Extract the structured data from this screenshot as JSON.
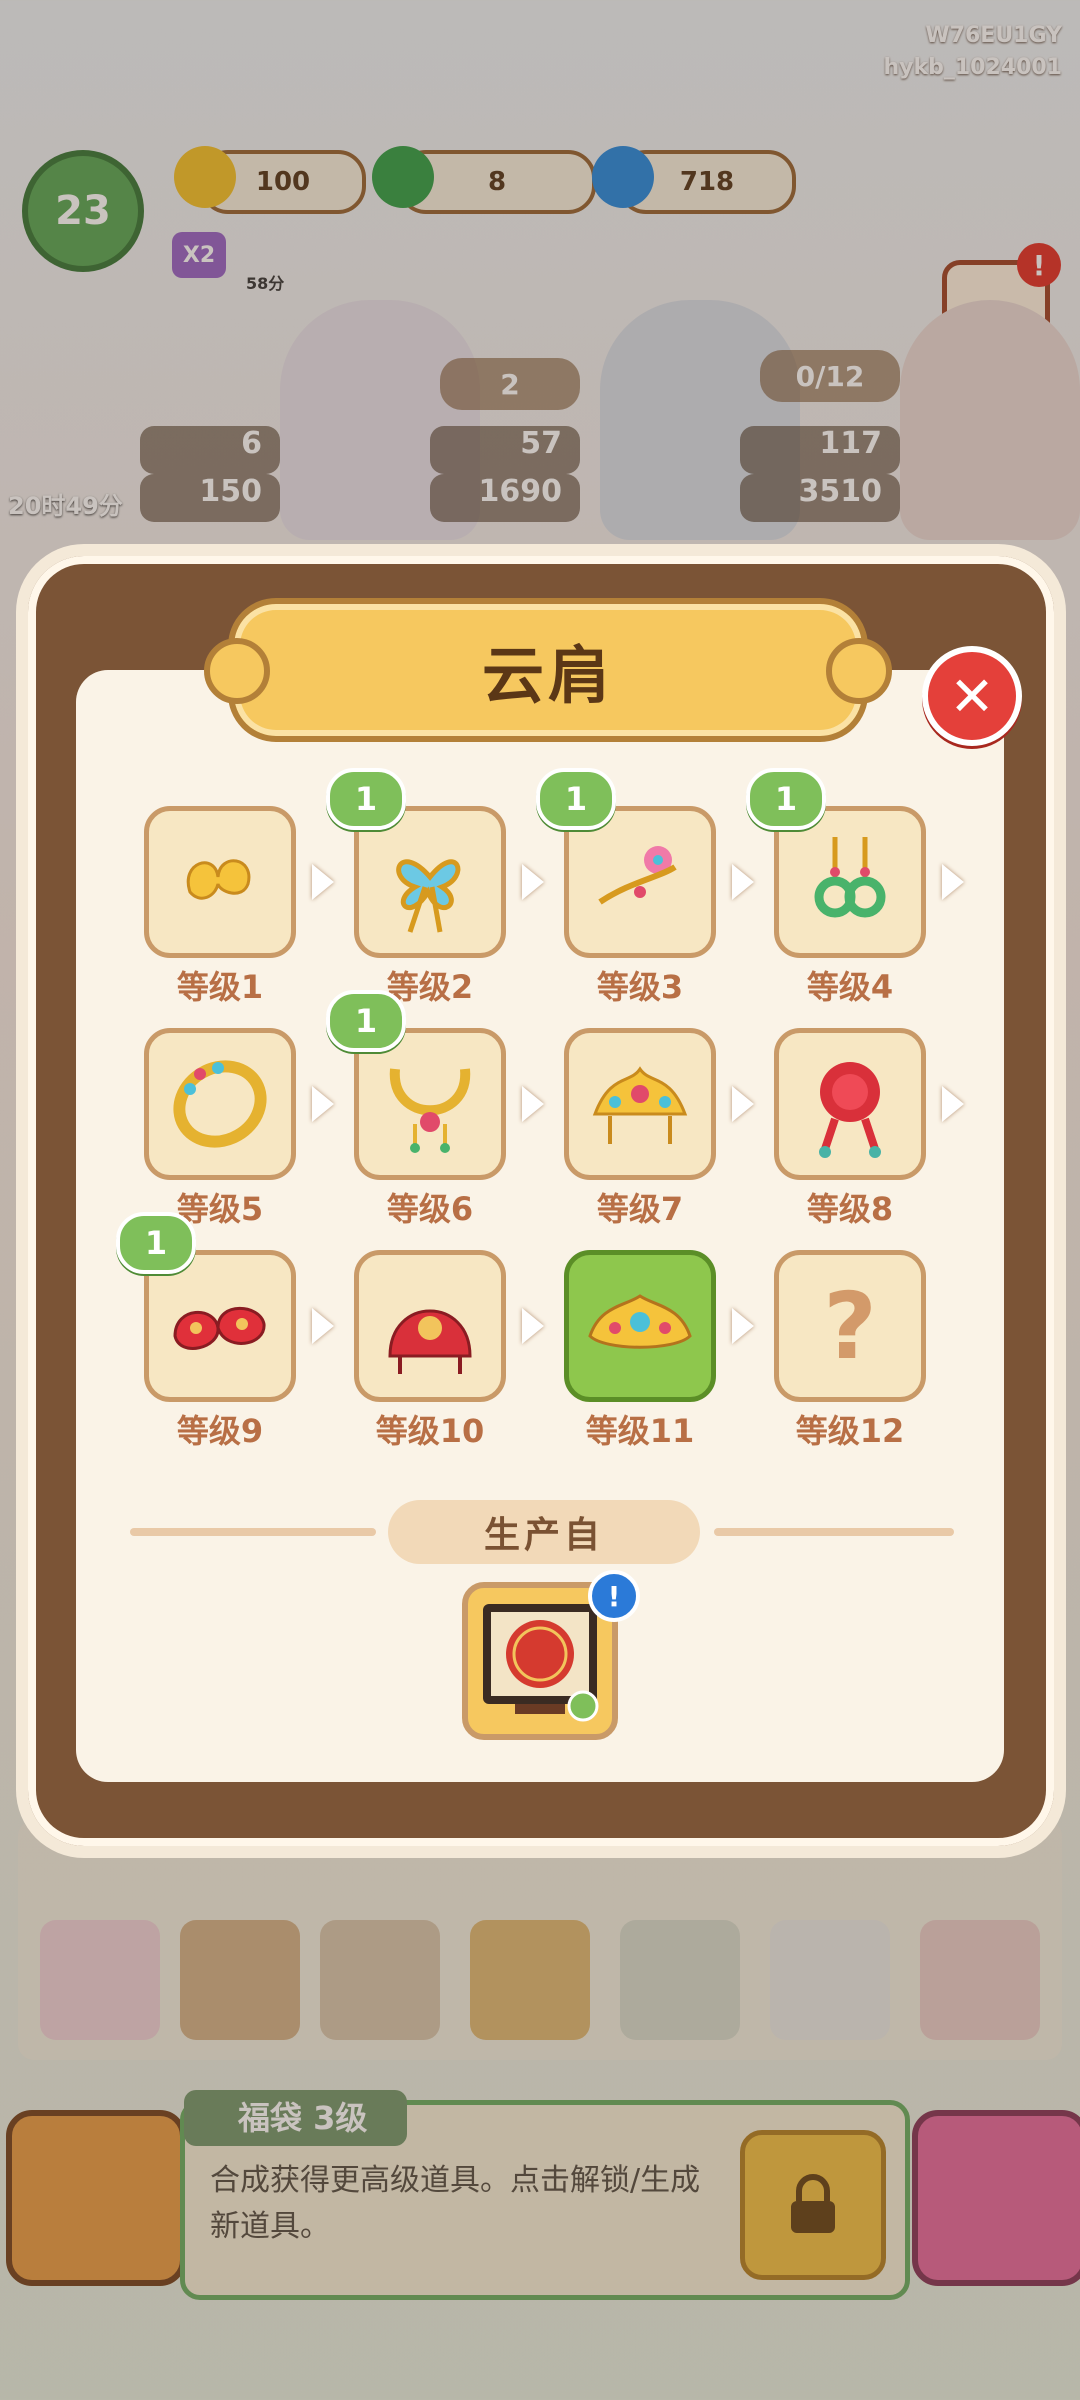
{
  "device_ids": {
    "line1": "W76EU1GY",
    "line2": "hykb_1024001"
  },
  "hud": {
    "player_level": "23",
    "energy": "100",
    "coins": "8",
    "gems": "718",
    "multiplier": "X2",
    "energy_timer": "58分",
    "orders": [
      {
        "top": "2",
        "coins": "57",
        "gems": "1690"
      },
      {
        "top": "0/12",
        "coins": "117",
        "gems": "3510"
      }
    ],
    "left_order": {
      "coins": "6",
      "gems": "150"
    },
    "event_timer": "20时49分",
    "shop_alert": "!"
  },
  "modal": {
    "title": "云肩",
    "close_icon": "close-icon",
    "levels": [
      {
        "label": "等级1",
        "icon": "ginkgo-hairpin-icon",
        "badge": ""
      },
      {
        "label": "等级2",
        "icon": "butterfly-hairpin-icon",
        "badge": "1"
      },
      {
        "label": "等级3",
        "icon": "flower-hairpin-icon",
        "badge": "1"
      },
      {
        "label": "等级4",
        "icon": "jade-earrings-icon",
        "badge": "1"
      },
      {
        "label": "等级5",
        "icon": "jeweled-bracelet-icon",
        "badge": ""
      },
      {
        "label": "等级6",
        "icon": "gold-necklace-icon",
        "badge": "1"
      },
      {
        "label": "等级7",
        "icon": "phoenix-crown-icon",
        "badge": ""
      },
      {
        "label": "等级8",
        "icon": "red-knot-icon",
        "badge": ""
      },
      {
        "label": "等级9",
        "icon": "embroidered-shoes-icon",
        "badge": "1"
      },
      {
        "label": "等级10",
        "icon": "red-veil-icon",
        "badge": ""
      },
      {
        "label": "等级11",
        "icon": "cloud-collar-icon",
        "badge": ""
      },
      {
        "label": "等级12",
        "icon": "unknown-item-icon",
        "badge": "",
        "unknown_mark": "?"
      }
    ],
    "produced_from_label": "生产自",
    "source_icon": "embroidery-frame-icon",
    "source_info": "!"
  },
  "bottom": {
    "item_title": "福袋 3级",
    "item_desc": "合成获得更高级道具。点击解锁/生成新道具。"
  },
  "colors": {
    "modal_frame": "#7b5436",
    "title_plate": "#f6c85f",
    "current_slot": "#8ec74d",
    "badge": "#7fbf5a",
    "close": "#e4403a"
  }
}
